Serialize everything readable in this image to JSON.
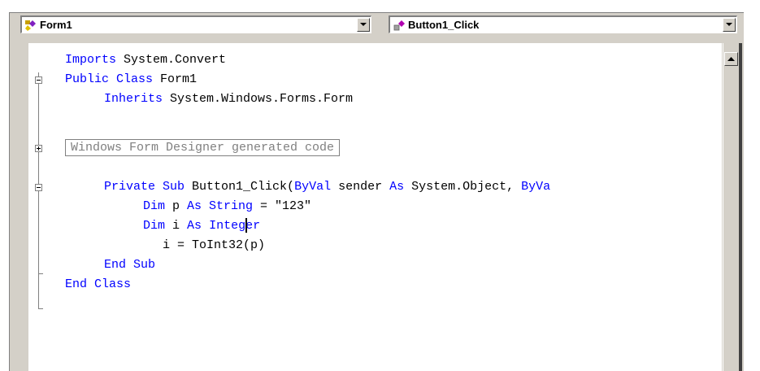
{
  "toolbar": {
    "class_combo": {
      "value": "Form1",
      "icon": "class-icon"
    },
    "method_combo": {
      "value": "Button1_Click",
      "icon": "method-icon"
    }
  },
  "code": {
    "line1": {
      "kw": "Imports",
      "rest": " System.Convert"
    },
    "line2": {
      "kw": "Public Class",
      "rest": " Form1"
    },
    "line3": {
      "kw": "Inherits",
      "rest": " System.Windows.Forms.Form"
    },
    "region": "Windows Form Designer generated code",
    "line5": {
      "kw1": "Private Sub",
      "t1": " Button1_Click(",
      "kw2": "ByVal",
      "t2": " sender ",
      "kw3": "As",
      "t3": " System.Object, ",
      "kw4": "ByVa"
    },
    "line6": {
      "kw1": "Dim",
      "t1": " p ",
      "kw2": "As String",
      "t2": " = \"123\""
    },
    "line7": {
      "kw1": "Dim",
      "t1": " i ",
      "kw2": "As",
      "t2": " ",
      "kw3": "Integer"
    },
    "line8": {
      "t1": "i = ToInt32(p)"
    },
    "line9": {
      "kw": "End Sub"
    },
    "line10": {
      "kw": "End Class"
    }
  },
  "colors": {
    "keyword": "#0000ff",
    "text": "#000000",
    "region": "#808080",
    "chrome": "#d4d0c8"
  }
}
